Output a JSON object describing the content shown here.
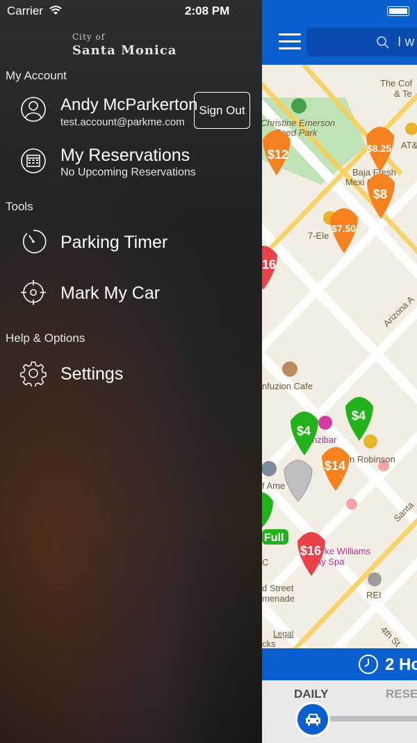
{
  "status": {
    "carrier": "Carrier",
    "time": "2:08 PM"
  },
  "logo": {
    "small": "City of",
    "big": "Santa Monica"
  },
  "sections": {
    "account": "My Account",
    "tools": "Tools",
    "help": "Help & Options"
  },
  "account": {
    "name": "Andy McParkerton",
    "email": "test.account@parkme.com",
    "sign_out": "Sign Out"
  },
  "reservations": {
    "title": "My Reservations",
    "subtitle": "No Upcoming Reservations"
  },
  "tools": {
    "timer": "Parking Timer",
    "mark_car": "Mark My Car"
  },
  "help": {
    "settings": "Settings"
  },
  "map": {
    "search_text": "I w",
    "bottom_label": "2 Ho",
    "tab_daily": "DAILY",
    "tab_reserve": "RESE",
    "places": {
      "park": "Christine Emerson",
      "park2": "Reed Park",
      "coffee": "The Cof",
      "coffee2": "& Te",
      "baja": "Baja Fresh",
      "baja2": "Mexi   Grill",
      "seven": "7-Ele",
      "infuzion": "nfuzion Cafe",
      "zanzibar": "nzibar",
      "robinson": "n Robinson",
      "burke": "rke Williams",
      "spa": "ay Spa",
      "ame": "f Ame",
      "third": "d Street",
      "third2": "menade",
      "rei": "REI",
      "fourth": "4th St",
      "legal": "Legal",
      "arizona": "Arizona A",
      "santa": "Santa",
      "full": "Full",
      "at": "AT&",
      "c": "C",
      "ks": "cks"
    },
    "pins": {
      "p12": "$12",
      "p825": "$8.25",
      "p8": "$8",
      "p750": "$7.50",
      "p16a": "16",
      "p4a": "$4",
      "p4b": "$4",
      "p14": "$14",
      "p16b": "$16"
    }
  },
  "colors": {
    "accent": "#0a5fcf",
    "orange": "#f5821f",
    "green": "#22b21b",
    "red": "#e8424b"
  }
}
